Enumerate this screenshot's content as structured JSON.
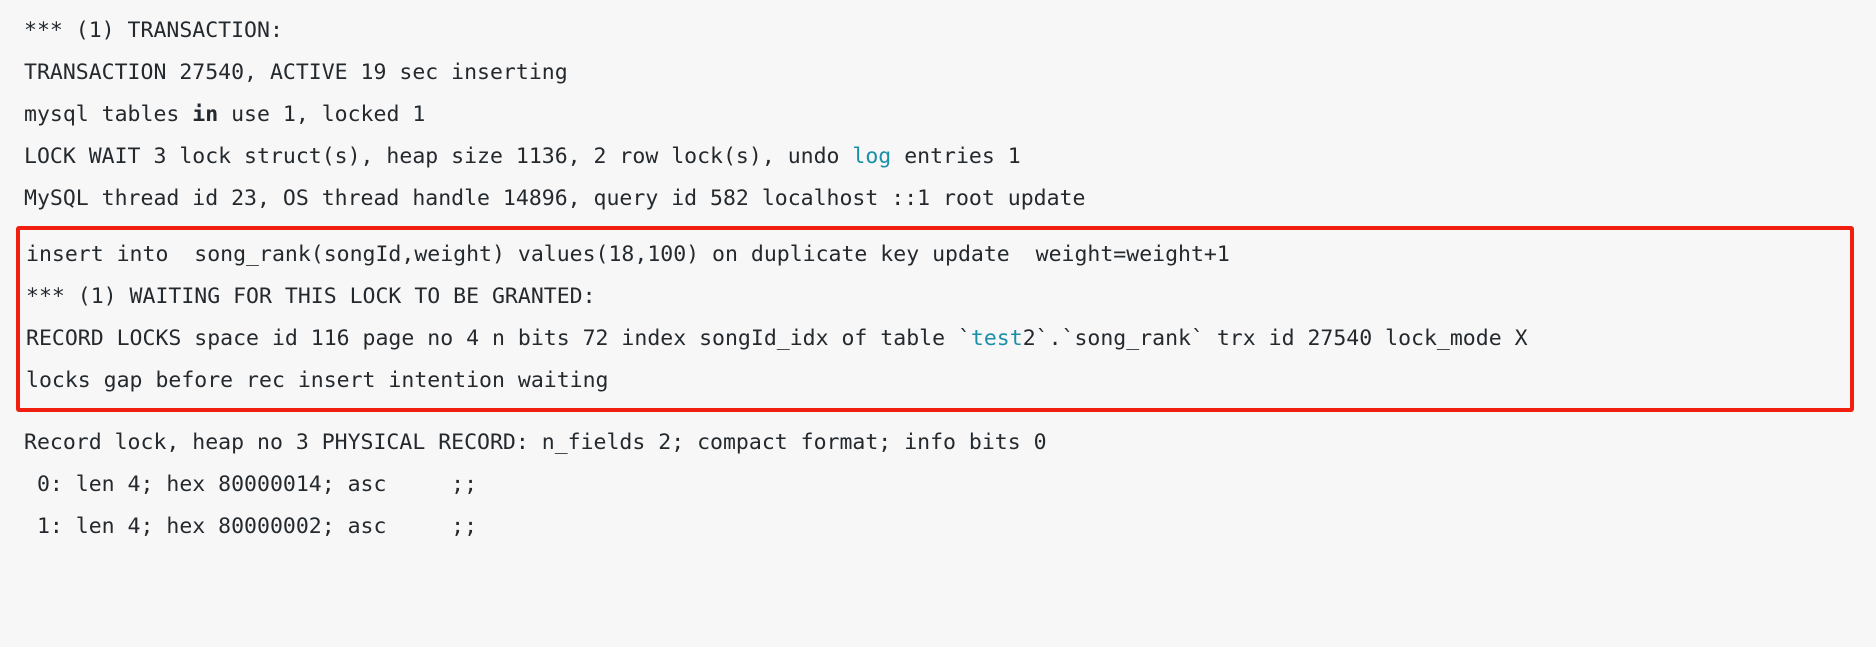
{
  "page": {
    "kind": "innodb-status-output",
    "background_color": "#f7f7f7",
    "text_color": "#24292e",
    "keyword_color": "#1b8fa8",
    "highlight_border_color": "#f01f0f"
  },
  "lines": {
    "l1": "*** (1) TRANSACTION:",
    "l2": "TRANSACTION 27540, ACTIVE 19 sec inserting",
    "l3_a": "mysql tables ",
    "l3_kw": "in",
    "l3_b": " use 1, locked 1",
    "l4_a": "LOCK WAIT 3 lock struct(s), heap size 1136, 2 row lock(s), undo ",
    "l4_kw": "log",
    "l4_b": " entries 1",
    "l5": "MySQL thread id 23, OS thread handle 14896, query id 582 localhost ::1 root update"
  },
  "highlight": {
    "l6": "insert into  song_rank(songId,weight) values(18,100) on duplicate key update  weight=weight+1",
    "l7": "*** (1) WAITING FOR THIS LOCK TO BE GRANTED:",
    "l8_a": "RECORD LOCKS space id 116 page no 4 n bits 72 index songId_idx of table `",
    "l8_kw": "test",
    "l8_b": "2`.`song_rank` trx id 27540 lock_mode X",
    "l9": "locks gap before rec insert intention waiting"
  },
  "tail": {
    "l10": "Record lock, heap no 3 PHYSICAL RECORD: n_fields 2; compact format; info bits 0",
    "l11": " 0: len 4; hex 80000014; asc     ;;",
    "l12": " 1: len 4; hex 80000002; asc     ;;"
  }
}
